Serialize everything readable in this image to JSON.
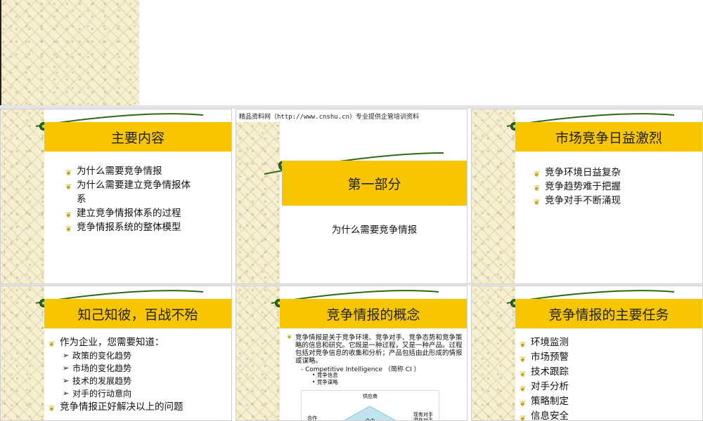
{
  "slide1": {
    "title": "主要内容",
    "items": [
      "为什么需要竞争情报",
      "为什么需要建立竞争情报体系",
      "建立竞争情报体系的过程",
      "竞争情报系统的整体模型"
    ]
  },
  "slide2": {
    "header": "精品资料网（http://www.cnshu.cn）专业提供企管培训资料",
    "title": "第一部分",
    "subtitle": "为什么需要竞争情报"
  },
  "slide3": {
    "title": "市场竞争日益激烈",
    "items": [
      "竞争环境日益复杂",
      "竞争趋势难于把握",
      "竞争对手不断涌现"
    ]
  },
  "slide4": {
    "title": "知己知彼，百战不殆",
    "intro": "作为企业，您需要知道：",
    "sub": [
      "政策的变化趋势",
      "市场的变化趋势",
      "技术的发展趋势",
      "对手的行动意向"
    ],
    "last": "竞争情报正好解决以上的问题"
  },
  "slide5": {
    "title": "竞争情报的概念",
    "body": "竞争情报是关于竞争环境、竞争对手、竞争态势和竞争策略的信息和研究。它既是一种过程，又是一种产品。过程包括对竞争信息的收集和分析；产品包括由此形成的情报或谋略。",
    "ci_line": "- Competitive Intelligence  （简称 CI ）",
    "sub": [
      "竞争信息",
      "竞争谋略"
    ],
    "diagram": {
      "top": "供应商",
      "left": "合作",
      "center": "企业",
      "right": "现有对手\n潜在对手"
    }
  },
  "slide6": {
    "title": "竞争情报的主要任务",
    "items": [
      "环境监测",
      "市场预警",
      "技术跟踪",
      "对手分析",
      "策略制定",
      "信息安全"
    ]
  },
  "colors": {
    "title_bar": "#f8c600",
    "swoosh": "#2f6a12",
    "background_pattern": "#f6efd2"
  }
}
